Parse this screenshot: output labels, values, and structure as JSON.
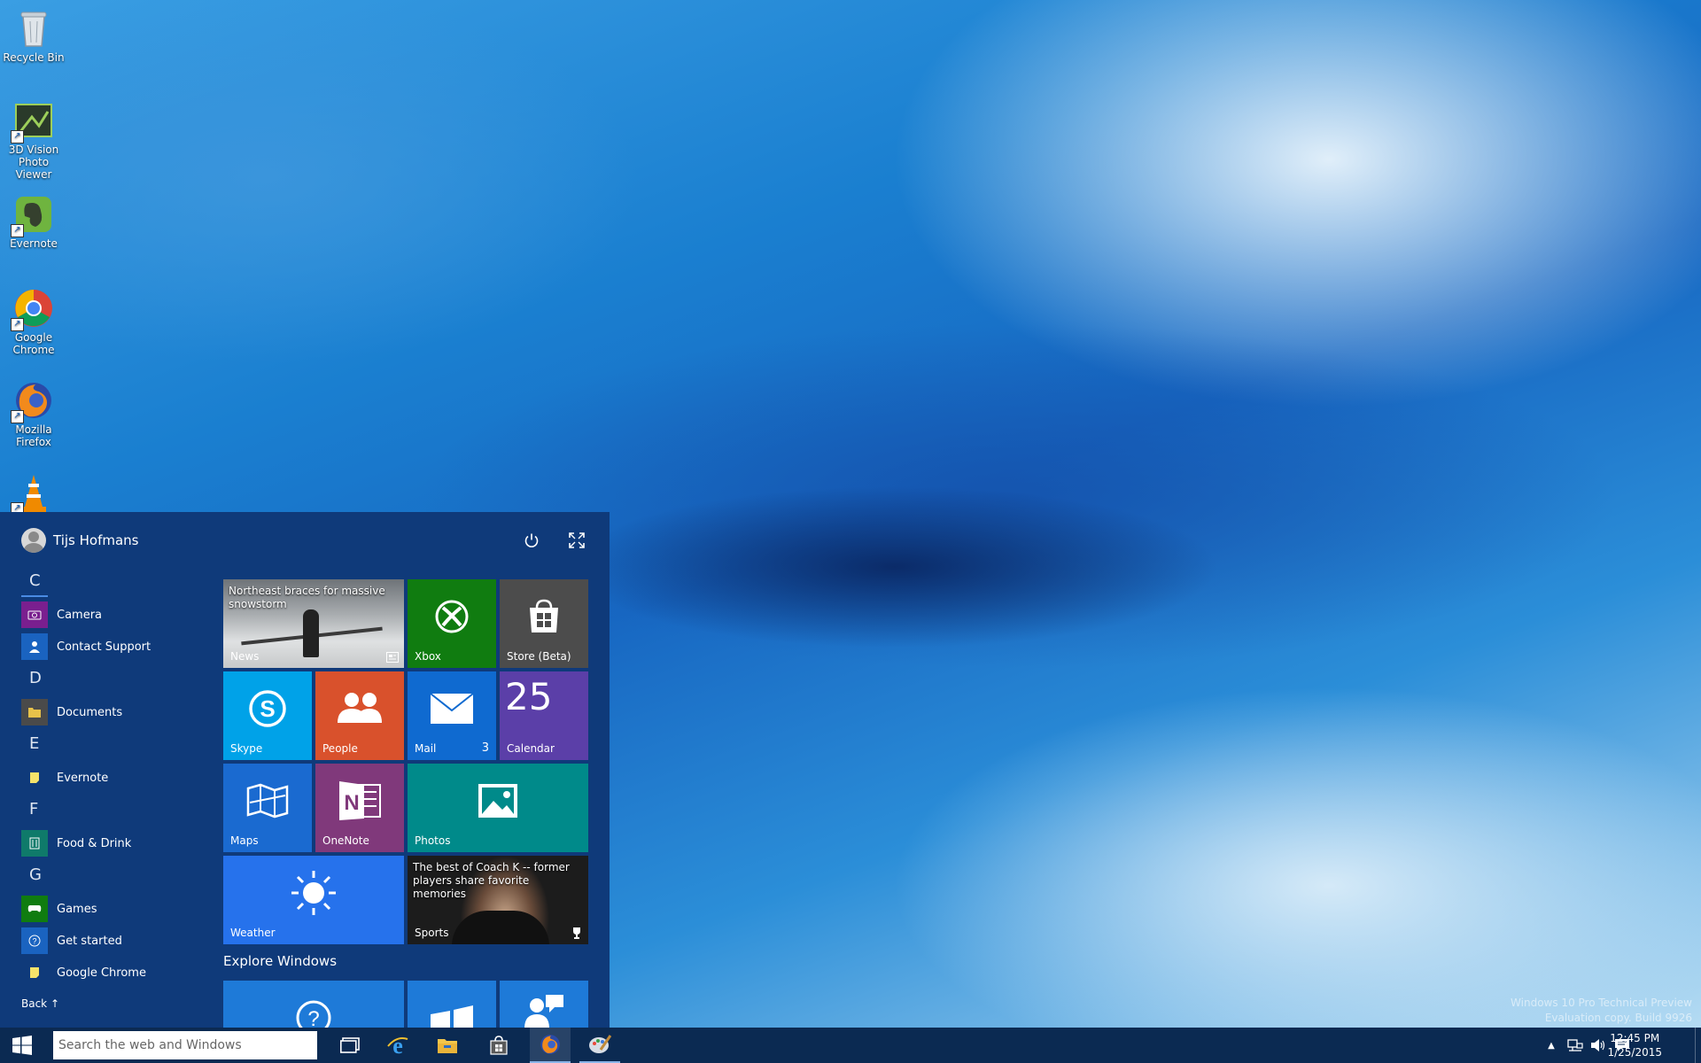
{
  "desktop": {
    "icons": [
      {
        "label": "Recycle Bin",
        "icon": "recycle-bin-icon"
      },
      {
        "label": "3D Vision Photo Viewer",
        "icon": "3d-vision-icon"
      },
      {
        "label": "Evernote",
        "icon": "evernote-icon"
      },
      {
        "label": "Google Chrome",
        "icon": "chrome-icon"
      },
      {
        "label": "Mozilla Firefox",
        "icon": "firefox-icon"
      },
      {
        "label": "",
        "icon": "vlc-icon"
      }
    ],
    "watermark": [
      "Windows 10 Pro Technical Preview",
      "Evaluation copy. Build 9926"
    ]
  },
  "start_menu": {
    "user_name": "Tijs Hofmans",
    "power_icon": "power-icon",
    "expand_icon": "fullscreen-icon",
    "app_list": [
      {
        "letter": "C",
        "apps": [
          {
            "label": "Camera",
            "color": "#7a1f8f",
            "icon": "camera-icon"
          },
          {
            "label": "Contact Support",
            "color": "#1a63c0",
            "icon": "person-icon"
          }
        ]
      },
      {
        "letter": "D",
        "apps": [
          {
            "label": "Documents",
            "color": "#4a4a4a",
            "icon": "documents-icon"
          }
        ]
      },
      {
        "letter": "E",
        "apps": [
          {
            "label": "Evernote",
            "color": "#0f3a7a",
            "icon": "note-icon"
          }
        ]
      },
      {
        "letter": "F",
        "apps": [
          {
            "label": "Food & Drink",
            "color": "#0f7a6a",
            "icon": "food-icon"
          }
        ]
      },
      {
        "letter": "G",
        "apps": [
          {
            "label": "Games",
            "color": "#107c10",
            "icon": "gamepad-icon"
          },
          {
            "label": "Get started",
            "color": "#1a63c0",
            "icon": "question-icon"
          },
          {
            "label": "Google Chrome",
            "color": "#0f3a7a",
            "icon": "note-icon"
          }
        ]
      }
    ],
    "back_label": "Back ↑",
    "tiles": {
      "news": {
        "headline": "Northeast braces for massive snowstorm",
        "label": "News"
      },
      "xbox": {
        "label": "Xbox",
        "color": "#107c10"
      },
      "store": {
        "label": "Store (Beta)",
        "color": "#4c4c4c"
      },
      "skype": {
        "label": "Skype",
        "color": "#00a2e8"
      },
      "people": {
        "label": "People",
        "color": "#d9512c"
      },
      "mail": {
        "label": "Mail",
        "badge": "3",
        "color": "#0f6ad0"
      },
      "calendar": {
        "label": "Calendar",
        "day": "25",
        "color": "#5b3fa8"
      },
      "maps": {
        "label": "Maps",
        "color": "#1a6ad0"
      },
      "onenote": {
        "label": "OneNote",
        "color": "#80397b"
      },
      "photos": {
        "label": "Photos",
        "color": "#008a8a"
      },
      "weather": {
        "label": "Weather",
        "color": "#2672ec"
      },
      "sports": {
        "headline": "The best of Coach K -- former players share favorite memories",
        "label": "Sports"
      }
    },
    "explore_title": "Explore Windows"
  },
  "taskbar": {
    "search_placeholder": "Search the web and Windows",
    "pinned": [
      {
        "icon": "task-view-icon"
      },
      {
        "icon": "internet-explorer-icon"
      },
      {
        "icon": "file-explorer-icon"
      },
      {
        "icon": "store-icon"
      },
      {
        "icon": "firefox-icon"
      },
      {
        "icon": "paint-icon"
      }
    ],
    "tray": {
      "time": "12:45 PM",
      "date": "1/25/2015"
    }
  }
}
